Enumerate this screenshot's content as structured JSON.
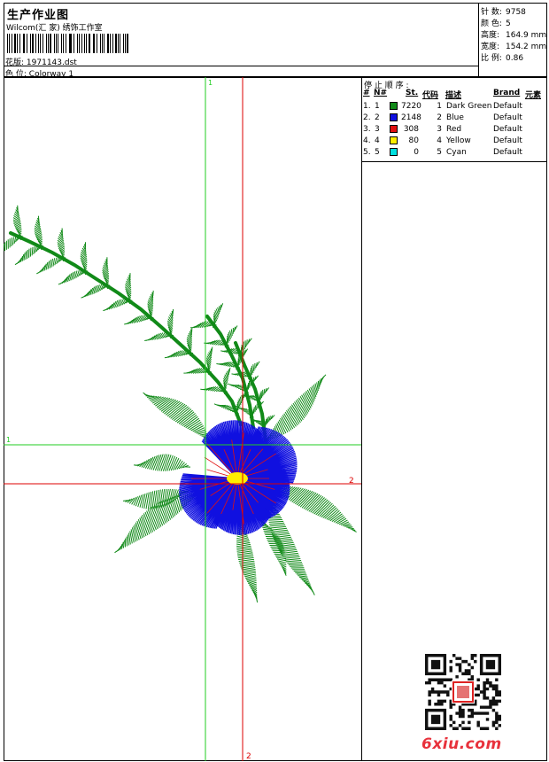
{
  "header": {
    "title": "生产作业图",
    "studio": "Wilcom(汇 家) 绣饰工作室",
    "design_label": "花版:",
    "design_value": "1971143.dst",
    "color_label": "色 位:",
    "color_value": "Colorway 1"
  },
  "stats": [
    {
      "label": "针 数:",
      "value": "9758"
    },
    {
      "label": "颜 色:",
      "value": "5"
    },
    {
      "label": "高度:",
      "value": "164.9 mm"
    },
    {
      "label": "宽度:",
      "value": "154.2 mm"
    },
    {
      "label": "比 例:",
      "value": "0.86"
    }
  ],
  "stop_sequence": {
    "title": "停 止 顺 序 :",
    "columns": {
      "hash": "#",
      "no": "N#",
      "st": "St.",
      "code": "代码",
      "desc": "描述",
      "brand": "Brand",
      "element": "元素"
    },
    "rows": [
      {
        "hash": "1.",
        "no": "1",
        "color": "#118a18",
        "st": "7220",
        "code": "1",
        "desc": "Dark Green",
        "brand": "Default"
      },
      {
        "hash": "2.",
        "no": "2",
        "color": "#1010e0",
        "st": "2148",
        "code": "2",
        "desc": "Blue",
        "brand": "Default"
      },
      {
        "hash": "3.",
        "no": "3",
        "color": "#e01010",
        "st": "308",
        "code": "3",
        "desc": "Red",
        "brand": "Default"
      },
      {
        "hash": "4.",
        "no": "4",
        "color": "#ffee00",
        "st": "80",
        "code": "4",
        "desc": "Yellow",
        "brand": "Default"
      },
      {
        "hash": "5.",
        "no": "5",
        "color": "#00e0e0",
        "st": "0",
        "code": "5",
        "desc": "Cyan",
        "brand": "Default"
      }
    ]
  },
  "guides": {
    "green_label_top": "1",
    "green_label_left": "1",
    "red_label_right": "2",
    "red_label_bottom": "2",
    "green_color": "#22cc22",
    "red_color": "#dd0000"
  },
  "watermark": {
    "site": "6xiu.com"
  },
  "colors": {
    "leaf": "#118a18",
    "petal": "#1010e0",
    "center": "#ffee00",
    "vein": "#e01010"
  }
}
